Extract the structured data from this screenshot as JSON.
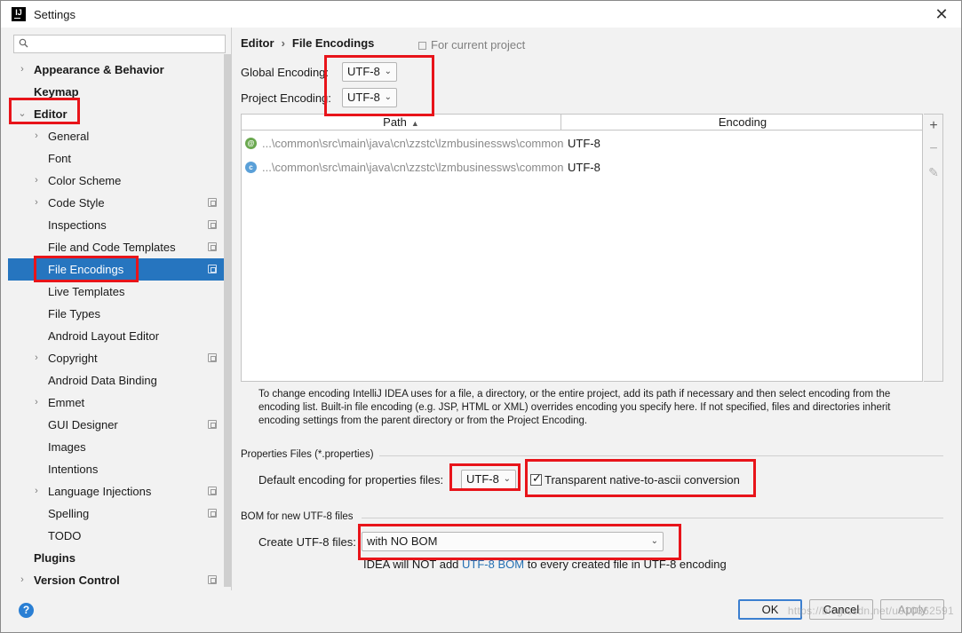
{
  "window": {
    "title": "Settings",
    "app_icon_text": "IJ",
    "close_glyph": "✕"
  },
  "sidebar": {
    "search_placeholder": "",
    "items": [
      {
        "label": "Appearance & Behavior",
        "level": 0,
        "bold": true,
        "chevron": "›",
        "expanded": false
      },
      {
        "label": "Keymap",
        "level": 0,
        "bold": true
      },
      {
        "label": "Editor",
        "level": 0,
        "bold": true,
        "chevron": "⌄",
        "expanded": true
      },
      {
        "label": "General",
        "level": 1,
        "chevron": "›"
      },
      {
        "label": "Font",
        "level": 1
      },
      {
        "label": "Color Scheme",
        "level": 1,
        "chevron": "›"
      },
      {
        "label": "Code Style",
        "level": 1,
        "chevron": "›",
        "project_scope": true
      },
      {
        "label": "Inspections",
        "level": 1,
        "project_scope": true
      },
      {
        "label": "File and Code Templates",
        "level": 1,
        "project_scope": true
      },
      {
        "label": "File Encodings",
        "level": 1,
        "project_scope": true,
        "selected": true
      },
      {
        "label": "Live Templates",
        "level": 1
      },
      {
        "label": "File Types",
        "level": 1
      },
      {
        "label": "Android Layout Editor",
        "level": 1
      },
      {
        "label": "Copyright",
        "level": 1,
        "chevron": "›",
        "project_scope": true
      },
      {
        "label": "Android Data Binding",
        "level": 1
      },
      {
        "label": "Emmet",
        "level": 1,
        "chevron": "›"
      },
      {
        "label": "GUI Designer",
        "level": 1,
        "project_scope": true
      },
      {
        "label": "Images",
        "level": 1
      },
      {
        "label": "Intentions",
        "level": 1
      },
      {
        "label": "Language Injections",
        "level": 1,
        "chevron": "›",
        "project_scope": true
      },
      {
        "label": "Spelling",
        "level": 1,
        "project_scope": true
      },
      {
        "label": "TODO",
        "level": 1
      },
      {
        "label": "Plugins",
        "level": 0,
        "bold": true
      },
      {
        "label": "Version Control",
        "level": 0,
        "bold": true,
        "chevron": "›",
        "project_scope": true
      }
    ]
  },
  "main": {
    "breadcrumb": [
      "Editor",
      "File Encodings"
    ],
    "breadcrumb_sep": "›",
    "scope_note": "For current project",
    "global_encoding": {
      "label": "Global Encoding:",
      "value": "UTF-8"
    },
    "project_encoding": {
      "label": "Project Encoding:",
      "value": "UTF-8"
    },
    "table": {
      "columns": [
        "Path",
        "Encoding"
      ],
      "sort_indicator": "▲",
      "rows": [
        {
          "icon": "@",
          "icon_color": "#6aa84f",
          "path": "...\\common\\src\\main\\java\\cn\\zzstc\\lzmbusinessws\\common",
          "encoding": "UTF-8"
        },
        {
          "icon": "c",
          "icon_color": "#5aa0d8",
          "path": "...\\common\\src\\main\\java\\cn\\zzstc\\lzmbusinessws\\common",
          "encoding": "UTF-8"
        }
      ],
      "tools": {
        "add": "+",
        "remove": "−",
        "edit": "✎"
      }
    },
    "help_text": "To change encoding IntelliJ IDEA uses for a file, a directory, or the entire project, add its path if necessary and then select encoding from the encoding list. Built-in file encoding (e.g. JSP, HTML or XML) overrides encoding you specify here. If not specified, files and directories inherit encoding settings from the parent directory or from the Project Encoding.",
    "properties": {
      "section_title": "Properties Files (*.properties)",
      "default_label": "Default encoding for properties files:",
      "default_value": "UTF-8",
      "native_to_ascii_label": "Transparent native-to-ascii conversion",
      "native_to_ascii_checked": true
    },
    "bom": {
      "section_title": "BOM for new UTF-8 files",
      "create_label": "Create UTF-8 files:",
      "create_value": "with NO BOM",
      "note_prefix": "IDEA will NOT add ",
      "note_link": "UTF-8 BOM",
      "note_suffix": " to every created file in UTF-8 encoding"
    }
  },
  "footer": {
    "help_glyph": "?",
    "ok": "OK",
    "cancel": "Cancel",
    "apply": "Apply",
    "watermark": "https://blog.csdn.net/u010362591"
  },
  "colors": {
    "selection": "#2675bf",
    "highlight": "#e8141a",
    "link": "#2470b3"
  }
}
